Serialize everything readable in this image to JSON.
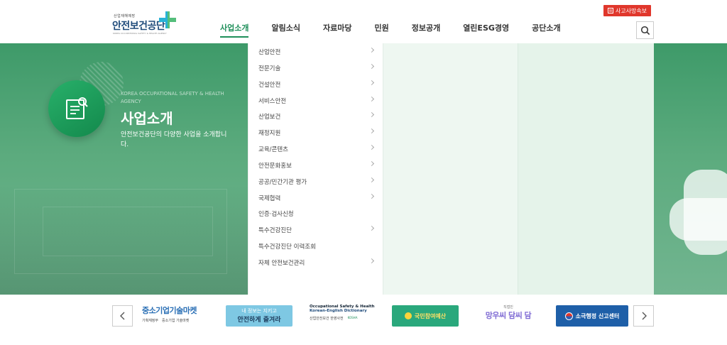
{
  "header": {
    "logo": {
      "small_text": "산업재해예방",
      "name": "안전보건공단",
      "eng_text": "KOREA OCCUPATIONAL SAFETY & HEALTH AGENCY"
    },
    "nav": [
      {
        "label": "사업소개",
        "active": true
      },
      {
        "label": "알림소식",
        "active": false
      },
      {
        "label": "자료마당",
        "active": false
      },
      {
        "label": "민원",
        "active": false
      },
      {
        "label": "정보공개",
        "active": false
      },
      {
        "label": "열린ESG경영",
        "active": false
      },
      {
        "label": "공단소개",
        "active": false
      }
    ],
    "accident_button": "사고사망속보",
    "search_icon": "search-icon"
  },
  "hero": {
    "subtitle": "KOREA OCCUPATIONAL SAFETY & HEALTH AGENCY",
    "title": "사업소개",
    "description": "안전보건공단의 다양한 사업을 소개합니다.",
    "badge_icon": "document-search-icon"
  },
  "submenu": [
    {
      "label": "산업안전",
      "arrow": true
    },
    {
      "label": "전문기술",
      "arrow": true
    },
    {
      "label": "건설안전",
      "arrow": true
    },
    {
      "label": "서비스안전",
      "arrow": true
    },
    {
      "label": "산업보건",
      "arrow": true
    },
    {
      "label": "재정지원",
      "arrow": true
    },
    {
      "label": "교육/콘텐츠",
      "arrow": true
    },
    {
      "label": "안전문화홍보",
      "arrow": true
    },
    {
      "label": "공공/민간기관 평가",
      "arrow": true
    },
    {
      "label": "국제협력",
      "arrow": true
    },
    {
      "label": "인증·검사신청",
      "arrow": false
    },
    {
      "label": "특수건강진단",
      "arrow": true
    },
    {
      "label": "특수건강진단 이력조회",
      "arrow": false
    },
    {
      "label": "자체 안전보건관리",
      "arrow": true
    }
  ],
  "banners": {
    "prev_icon": "chevron-left-icon",
    "next_icon": "chevron-right-icon",
    "b1": {
      "title": "중소기업기술마켓",
      "sub1": "기획재정부",
      "sub2": "중소기업 기술마켓"
    },
    "b2": {
      "line1": "내 정보는 지키고",
      "line2": "안전하게 즐겨라"
    },
    "b3": {
      "line1": "Occupational Safety & Health",
      "line2": "Korean-English Dictionary",
      "line3": "산업안전보건 한영사전",
      "line4": "KOSHA"
    },
    "b4": {
      "text": "국민참여예산"
    },
    "b5": {
      "small": "직접민",
      "text": "망우씨 담씨 담"
    },
    "b6": {
      "text": "소극행정 신고센터"
    },
    "colors": {
      "green": "#1f8f5a",
      "red": "#e0372c",
      "navy": "#1e4a7a"
    }
  }
}
